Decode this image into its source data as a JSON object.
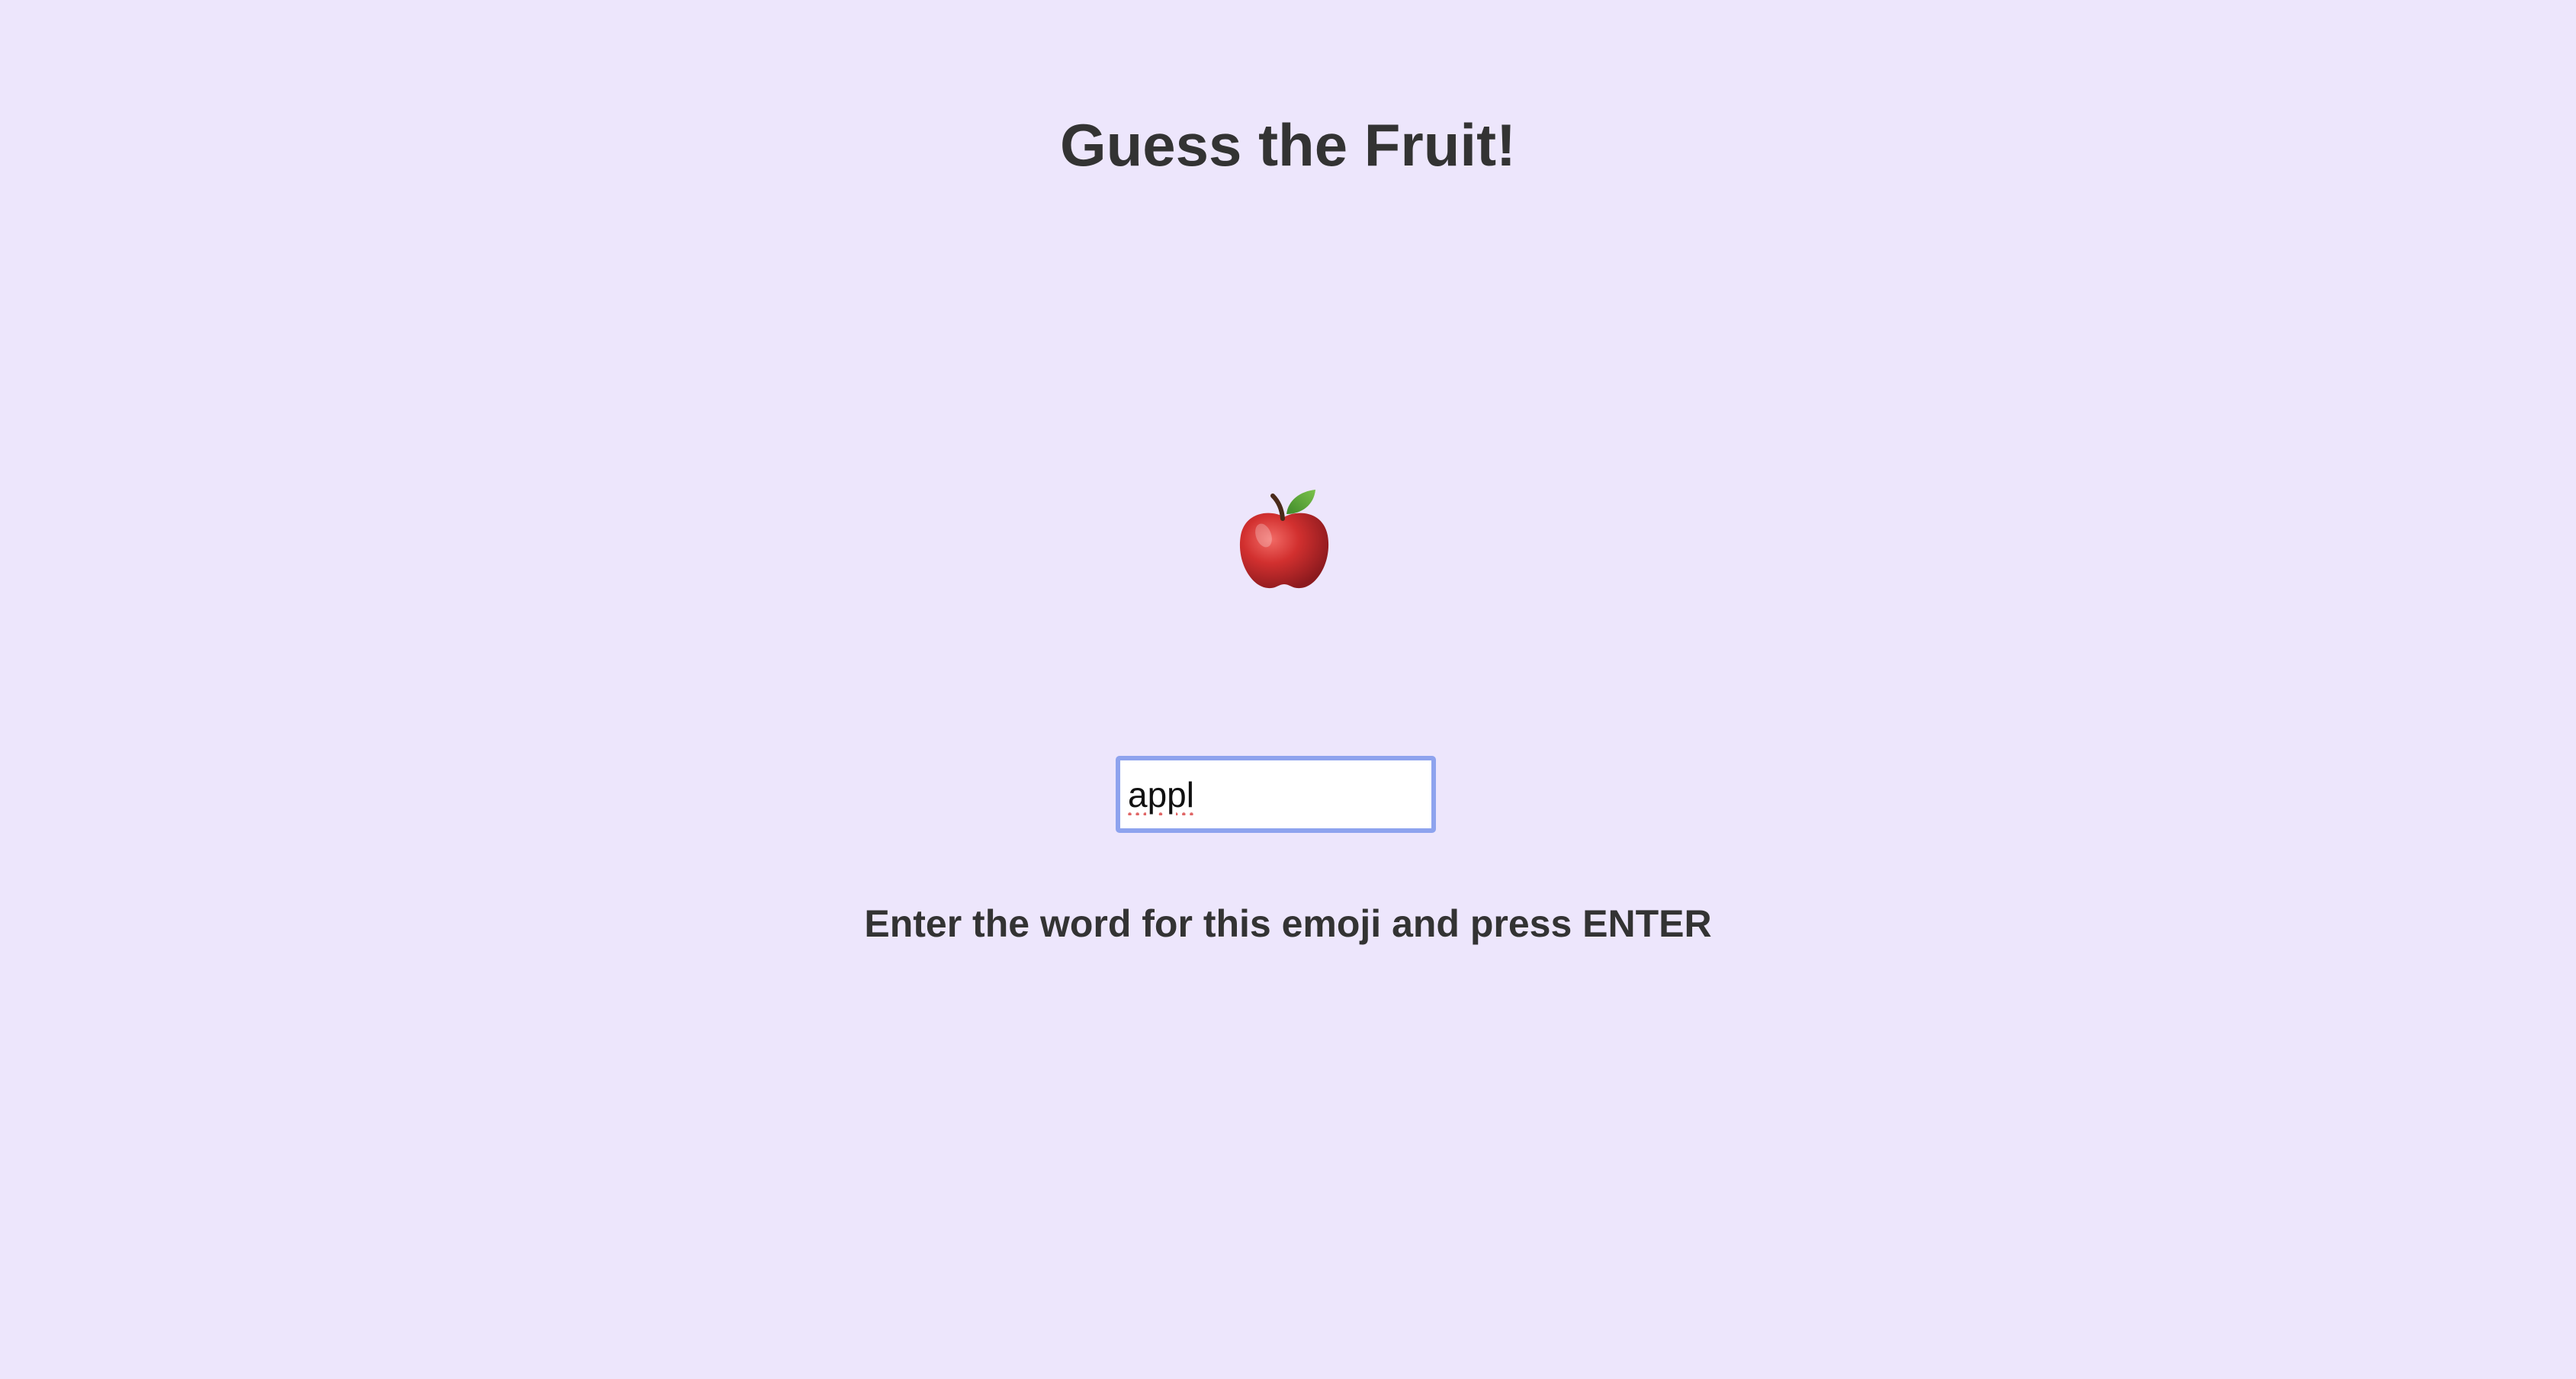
{
  "game": {
    "title": "Guess the Fruit!",
    "emoji": {
      "name": "apple-icon",
      "glyph": "🍎"
    },
    "input": {
      "value": "appl",
      "placeholder": ""
    },
    "instruction": "Enter the word for this emoji and press ENTER"
  },
  "colors": {
    "background": "#ede6fc",
    "text": "#333333",
    "input_border_focus": "#8ea3ee",
    "apple_red": "#c8262c",
    "leaf_green": "#5ca83a"
  }
}
